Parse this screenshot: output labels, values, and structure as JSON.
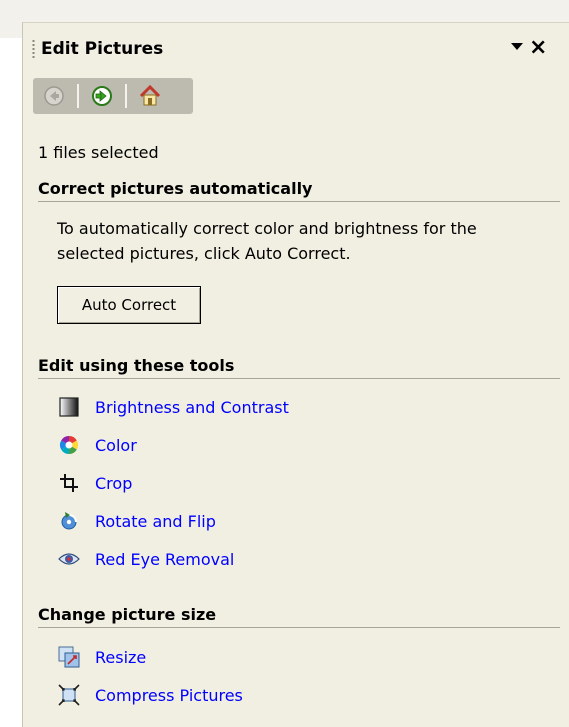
{
  "pane": {
    "title": "Edit Pictures",
    "close_glyph": "×"
  },
  "toolbar": {
    "back_icon": "back-arrow-icon",
    "forward_icon": "forward-arrow-icon",
    "home_icon": "home-icon"
  },
  "selection": {
    "status": "1 files selected"
  },
  "auto_correct": {
    "header": "Correct pictures automatically",
    "description_line1": "To automatically correct color and brightness for the",
    "description_line2": "selected pictures, click Auto Correct.",
    "button_label": "Auto Correct"
  },
  "edit_tools": {
    "header": "Edit using these tools",
    "items": [
      {
        "label": "Brightness and Contrast",
        "icon": "brightness-contrast-icon"
      },
      {
        "label": "Color",
        "icon": "color-wheel-icon"
      },
      {
        "label": "Crop",
        "icon": "crop-icon"
      },
      {
        "label": "Rotate and Flip",
        "icon": "rotate-flip-icon"
      },
      {
        "label": "Red Eye Removal",
        "icon": "red-eye-icon"
      }
    ]
  },
  "picture_size": {
    "header": "Change picture size",
    "items": [
      {
        "label": "Resize",
        "icon": "resize-icon"
      },
      {
        "label": "Compress Pictures",
        "icon": "compress-pictures-icon"
      }
    ]
  },
  "colors": {
    "pane_background": "#f1efe2",
    "link": "#0000ff",
    "toolbar": "#bdbab0"
  }
}
